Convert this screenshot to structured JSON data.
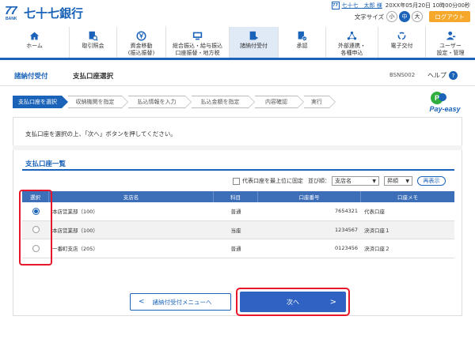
{
  "header": {
    "logo_mark": "77",
    "logo_sub": "BANK",
    "logo_text": "七十七銀行",
    "user_icon": "77",
    "user_name": "七十七　太郎 様",
    "login_time": "20XX年05月20日 10時00分00秒",
    "font_size_label": "文字サイズ",
    "font_sizes": [
      "小",
      "中",
      "大"
    ],
    "font_size_selected": "中",
    "logout": "ログアウト"
  },
  "nav": [
    {
      "label": "ホーム",
      "icon": "home-icon"
    },
    {
      "label": "取引照会",
      "icon": "document-search-icon"
    },
    {
      "label": "資金移動\n(振込振替)",
      "icon": "yen-transfer-icon"
    },
    {
      "label": "総合振込・給与振込\n口座振替・地方税",
      "icon": "monitor-icon"
    },
    {
      "label": "諸納付受付",
      "icon": "payment-icon"
    },
    {
      "label": "承認",
      "icon": "approval-icon"
    },
    {
      "label": "外部連携・\n各種申込",
      "icon": "link-icon"
    },
    {
      "label": "電子交付",
      "icon": "sync-icon"
    },
    {
      "label": "ユーザー\n設定・管理",
      "icon": "user-settings-icon"
    }
  ],
  "nav_active": "諸納付受付",
  "page": {
    "category": "諸納付受付",
    "title": "支払口座選択",
    "code": "BSNS002",
    "help": "ヘルプ"
  },
  "steps": [
    "支払口座を選択",
    "収納機関を指定",
    "払込情報を入力",
    "払込金額を指定",
    "内容確認",
    "実行"
  ],
  "current_step": 0,
  "payeasy": "Pay-easy",
  "instruction": "支払口座を選択の上、「次へ」ボタンを押してください。",
  "section_title": "支払口座一覧",
  "controls": {
    "pin_label": "代表口座を最上位に固定",
    "sort_label": "並び順：",
    "sort_field": "支店名",
    "sort_order": "昇順",
    "redisplay": "再表示"
  },
  "table": {
    "headers": [
      "選択",
      "支店名",
      "科目",
      "口座番号",
      "口座メモ"
    ],
    "rows": [
      {
        "selected": true,
        "branch": "本店営業部（100）",
        "type": "普通",
        "number": "7654321",
        "memo": "代表口座"
      },
      {
        "selected": false,
        "branch": "本店営業部（100）",
        "type": "当座",
        "number": "1234567",
        "memo": "決済口座１"
      },
      {
        "selected": false,
        "branch": "一番町支店（205）",
        "type": "普通",
        "number": "0123456",
        "memo": "決済口座２"
      }
    ]
  },
  "buttons": {
    "back": "諸納付受付メニューへ",
    "next": "次へ"
  },
  "colors": {
    "primary": "#1a63b8",
    "table_header": "#3d6fb8",
    "next_button": "#2f62c2",
    "logout": "#f5a82b",
    "highlight": "#e8162a"
  }
}
